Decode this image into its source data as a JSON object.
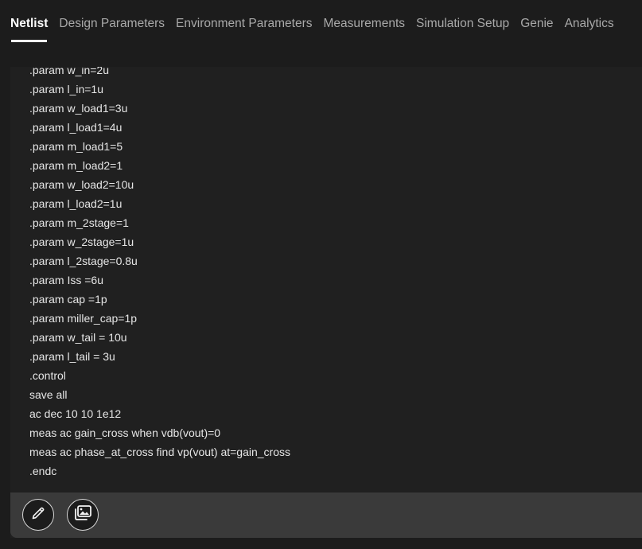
{
  "tabs": [
    {
      "label": "Netlist",
      "active": true
    },
    {
      "label": "Design Parameters",
      "active": false
    },
    {
      "label": "Environment Parameters",
      "active": false
    },
    {
      "label": "Measurements",
      "active": false
    },
    {
      "label": "Simulation Setup",
      "active": false
    },
    {
      "label": "Genie",
      "active": false
    },
    {
      "label": "Analytics",
      "active": false
    }
  ],
  "netlist": {
    "lines": [
      ".param w_in=2u",
      ".param l_in=1u",
      ".param w_load1=3u",
      ".param l_load1=4u",
      ".param m_load1=5",
      ".param m_load2=1",
      ".param w_load2=10u",
      ".param l_load2=1u",
      ".param m_2stage=1",
      ".param w_2stage=1u",
      ".param l_2stage=0.8u",
      ".param Iss =6u",
      ".param cap =1p",
      ".param miller_cap=1p",
      ".param w_tail = 10u",
      ".param l_tail = 3u",
      ".control",
      "save all",
      "ac dec 10 10 1e12",
      "meas ac gain_cross when vdb(vout)=0",
      "meas ac phase_at_cross find vp(vout) at=gain_cross",
      ".endc"
    ]
  },
  "footer": {
    "edit_icon": "pencil-icon",
    "image_icon": "images-icon"
  },
  "colors": {
    "background": "#1c1c1c",
    "panel": "#202020",
    "footer": "#3a3a3a",
    "active_tab": "#ffffff",
    "inactive_tab": "#a9a9a9"
  }
}
